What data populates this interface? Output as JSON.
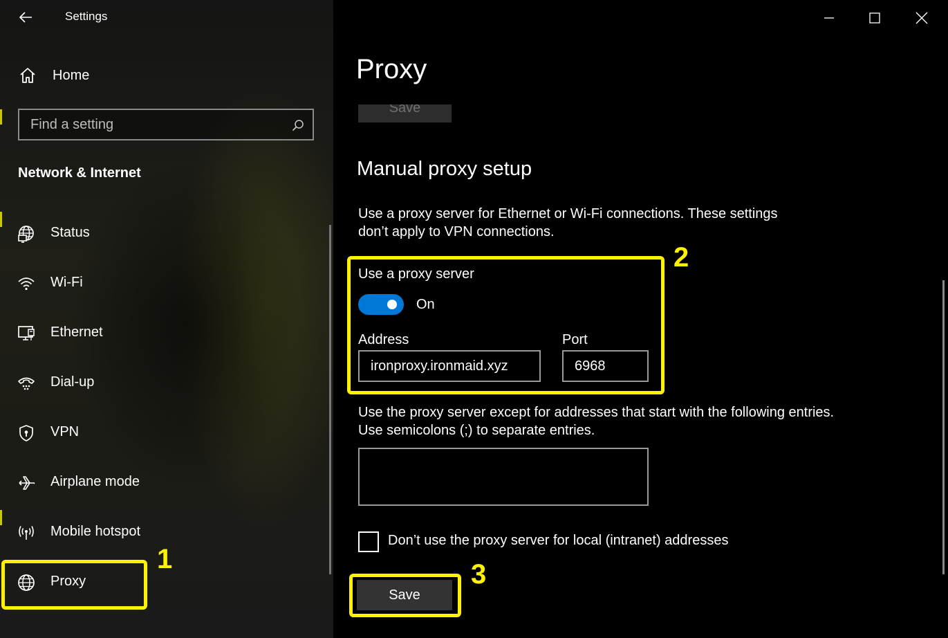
{
  "window": {
    "title": "Settings"
  },
  "sidebar": {
    "home_label": "Home",
    "search_placeholder": "Find a setting",
    "section_title": "Network & Internet",
    "items": [
      {
        "label": "Status",
        "icon": "globe-monitor-icon"
      },
      {
        "label": "Wi-Fi",
        "icon": "wifi-icon"
      },
      {
        "label": "Ethernet",
        "icon": "ethernet-icon"
      },
      {
        "label": "Dial-up",
        "icon": "dial-up-icon"
      },
      {
        "label": "VPN",
        "icon": "vpn-shield-icon"
      },
      {
        "label": "Airplane mode",
        "icon": "airplane-icon"
      },
      {
        "label": "Mobile hotspot",
        "icon": "hotspot-icon"
      },
      {
        "label": "Proxy",
        "icon": "globe-icon",
        "selected": true
      }
    ]
  },
  "main": {
    "page_title": "Proxy",
    "previous_save_label": "Save",
    "manual_title": "Manual proxy setup",
    "manual_description": "Use a proxy server for Ethernet or Wi-Fi connections. These settings don’t apply to VPN connections.",
    "use_proxy_label": "Use a proxy server",
    "toggle_state": "On",
    "toggle_on": true,
    "address_label": "Address",
    "address_value": "ironproxy.ironmaid.xyz",
    "port_label": "Port",
    "port_value": "6968",
    "exceptions_description": "Use the proxy server except for addresses that start with the following entries. Use semicolons (;) to separate entries.",
    "exceptions_value": "",
    "local_checkbox_label": "Don’t use the proxy server for local (intranet) addresses",
    "local_checkbox_checked": false,
    "save_label": "Save"
  },
  "annotations": {
    "step1": "1",
    "step2": "2",
    "step3": "3",
    "highlight_color": "#fff200"
  },
  "colors": {
    "accent": "#0078d7"
  }
}
